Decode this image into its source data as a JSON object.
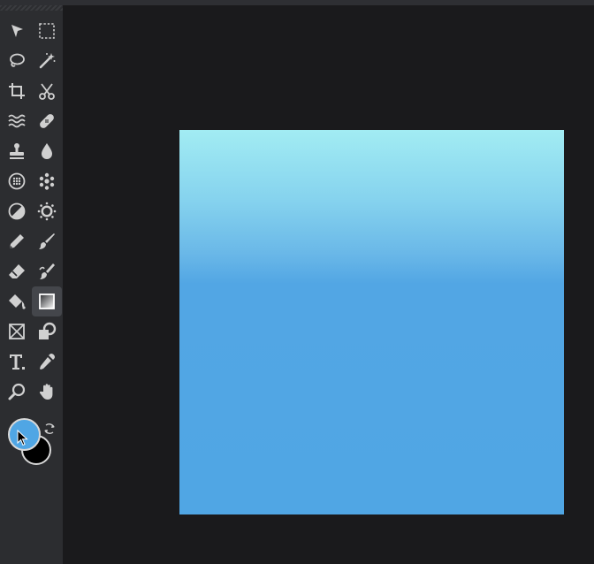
{
  "colors": {
    "toolbar_bg": "#2c2d30",
    "workspace_bg": "#1a1a1c",
    "icon": "#d0d0d0",
    "active_tool_bg": "#44464b",
    "foreground": "#50a6e4",
    "background": "#000000",
    "gradient_top": "#a2ecf3",
    "gradient_bottom": "#50a6e4"
  },
  "tools": [
    {
      "name": "move-tool",
      "icon": "arrow-pointer-icon"
    },
    {
      "name": "marquee-select-tool",
      "icon": "dashed-rectangle-icon"
    },
    {
      "name": "lasso-tool",
      "icon": "lasso-icon"
    },
    {
      "name": "magic-wand-tool",
      "icon": "magic-wand-icon"
    },
    {
      "name": "crop-tool",
      "icon": "crop-icon"
    },
    {
      "name": "slice-tool",
      "icon": "scissors-icon"
    },
    {
      "name": "smudge-tool",
      "icon": "wavy-lines-icon"
    },
    {
      "name": "healing-tool",
      "icon": "bandage-icon"
    },
    {
      "name": "clone-stamp-tool",
      "icon": "stamp-icon"
    },
    {
      "name": "blur-tool",
      "icon": "droplet-icon"
    },
    {
      "name": "pattern-tool",
      "icon": "dotted-circle-icon"
    },
    {
      "name": "spray-tool",
      "icon": "spray-dots-icon"
    },
    {
      "name": "dodge-burn-tool",
      "icon": "half-circle-icon"
    },
    {
      "name": "sponge-tool",
      "icon": "sun-gear-icon"
    },
    {
      "name": "pencil-tool",
      "icon": "pencil-icon"
    },
    {
      "name": "brush-tool",
      "icon": "paintbrush-icon"
    },
    {
      "name": "eraser-tool",
      "icon": "eraser-icon"
    },
    {
      "name": "mixer-brush-tool",
      "icon": "brush-pen-icon"
    },
    {
      "name": "paint-bucket-tool",
      "icon": "paint-bucket-icon"
    },
    {
      "name": "gradient-tool",
      "icon": "gradient-square-icon"
    },
    {
      "name": "shape-tool",
      "icon": "crossed-rectangle-icon"
    },
    {
      "name": "lock-shape-tool",
      "icon": "shapes-icon"
    },
    {
      "name": "text-tool",
      "icon": "text-icon"
    },
    {
      "name": "eyedropper-tool",
      "icon": "eyedropper-icon"
    },
    {
      "name": "zoom-tool",
      "icon": "magnifier-icon"
    },
    {
      "name": "hand-tool",
      "icon": "hand-icon"
    }
  ],
  "active_tool": "gradient-tool"
}
